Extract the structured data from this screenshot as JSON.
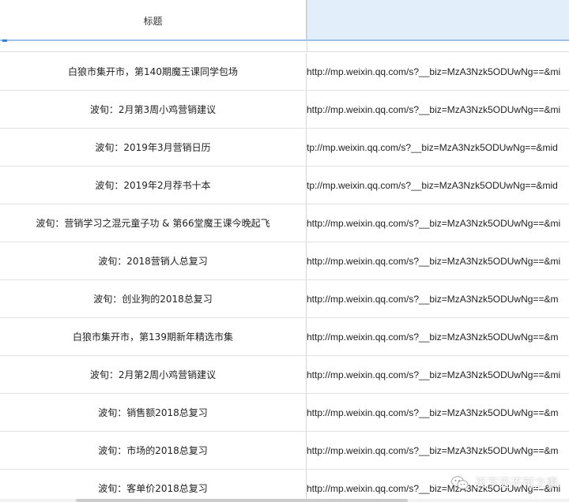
{
  "table": {
    "header": {
      "title_column": "标题",
      "link_column": ""
    },
    "rows": [
      {
        "title": "白狼市集开市，第140期魔王课同学包场",
        "link": "http://mp.weixin.qq.com/s?__biz=MzA3Nzk5ODUwNg==&mi"
      },
      {
        "title": "波旬：2月第3周小鸡营销建议",
        "link": "http://mp.weixin.qq.com/s?__biz=MzA3Nzk5ODUwNg==&mi"
      },
      {
        "title": "波旬：2019年3月营销日历",
        "link": "tp://mp.weixin.qq.com/s?__biz=MzA3Nzk5ODUwNg==&mid"
      },
      {
        "title": "波旬：2019年2月荐书十本",
        "link": "tp://mp.weixin.qq.com/s?__biz=MzA3Nzk5ODUwNg==&mid"
      },
      {
        "title": "波旬：营销学习之混元童子功 & 第66堂魔王课今晚起飞",
        "link": "http://mp.weixin.qq.com/s?__biz=MzA3Nzk5ODUwNg==&mi"
      },
      {
        "title": "波旬：2018营销人总复习",
        "link": "http://mp.weixin.qq.com/s?__biz=MzA3Nzk5ODUwNg==&mi"
      },
      {
        "title": "波旬：创业狗的2018总复习",
        "link": "http://mp.weixin.qq.com/s?__biz=MzA3Nzk5ODUwNg==&m"
      },
      {
        "title": "白狼市集开市，第139期新年精选市集",
        "link": "http://mp.weixin.qq.com/s?__biz=MzA3Nzk5ODUwNg==&m"
      },
      {
        "title": "波旬：2月第2周小鸡营销建议",
        "link": "http://mp.weixin.qq.com/s?__biz=MzA3Nzk5ODUwNg==&mi"
      },
      {
        "title": "波旬：销售额2018总复习",
        "link": "http://mp.weixin.qq.com/s?__biz=MzA3Nzk5ODUwNg==&m"
      },
      {
        "title": "波旬：市场的2018总复习",
        "link": "http://mp.weixin.qq.com/s?__biz=MzA3Nzk5ODUwNg==&m"
      },
      {
        "title": "波旬：客单价2018总复习",
        "link": "http://mp.weixin.qq.com/s?__biz=MzA3Nzk5ODUwNg==&mi"
      }
    ]
  },
  "watermark": {
    "text": "天下无不可之事",
    "icon": "wechat-icon"
  },
  "colors": {
    "header_link_bg": "#e3eefb",
    "header_underline": "#9ec1ea",
    "grid_line": "#e2e2e2"
  }
}
